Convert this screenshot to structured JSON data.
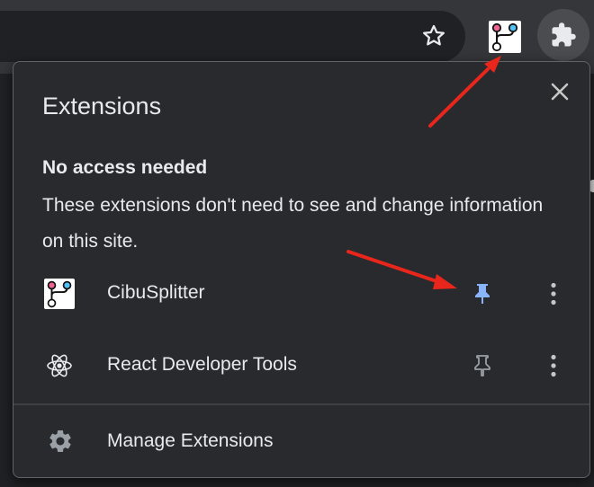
{
  "toolbar": {
    "star_icon": "star-outline-icon",
    "extension_icon": "cibusplitter-icon",
    "puzzle_icon": "puzzle-piece-icon"
  },
  "popup": {
    "title": "Extensions",
    "close_icon": "close-icon",
    "section": {
      "heading": "No access needed",
      "description": "These extensions don't need to see and change information on this site."
    },
    "extensions": [
      {
        "name": "CibuSplitter",
        "icon": "cibusplitter-icon",
        "pinned": true,
        "pin_color": "#8ab4f8"
      },
      {
        "name": "React Developer Tools",
        "icon": "react-icon",
        "pinned": false,
        "pin_color": "#9aa0a6"
      }
    ],
    "manage": {
      "label": "Manage Extensions",
      "icon": "gear-icon"
    }
  },
  "annotations": {
    "arrow_color": "#e8261c"
  },
  "colors": {
    "toolbar_bg": "#35363a",
    "popup_bg": "#292a2d",
    "text": "#e8eaed",
    "accent_blue": "#8ab4f8"
  }
}
